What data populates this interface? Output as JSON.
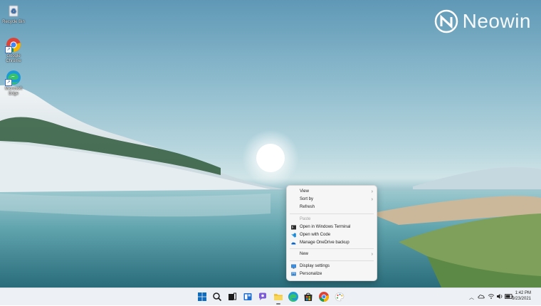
{
  "desktop_icons": [
    {
      "label": "Recycle Bin",
      "icon": "recycle-bin-icon"
    },
    {
      "label": "Google Chrome",
      "icon": "chrome-icon"
    },
    {
      "label": "Microsoft Edge",
      "icon": "edge-icon"
    }
  ],
  "watermark": {
    "text": "Neowin"
  },
  "context_menu": {
    "items": [
      {
        "label": "View",
        "submenu": true
      },
      {
        "label": "Sort by",
        "submenu": true
      },
      {
        "label": "Refresh"
      },
      {
        "label": "Paste",
        "disabled": true
      },
      {
        "label": "Open in Windows Terminal",
        "icon": "terminal-icon"
      },
      {
        "label": "Open with Code",
        "icon": "vscode-icon"
      },
      {
        "label": "Manage OneDrive backup",
        "icon": "onedrive-icon"
      },
      {
        "label": "New",
        "submenu": true
      },
      {
        "label": "Display settings",
        "icon": "display-icon"
      },
      {
        "label": "Personalize",
        "icon": "personalize-icon"
      }
    ]
  },
  "taskbar": {
    "apps": [
      "windows-start-icon",
      "search-icon",
      "task-view-icon",
      "widgets-icon",
      "chat-icon",
      "file-explorer-icon",
      "edge-icon",
      "store-icon",
      "chrome-icon",
      "paint-icon"
    ],
    "tray_icons": [
      "chevron-up-icon",
      "onedrive-icon",
      "wifi-icon",
      "volume-icon",
      "battery-icon"
    ],
    "time": "1:42 PM",
    "date": "9/23/2021"
  },
  "colors": {
    "accent": "#0067c0",
    "menu_bg": "#f6f6f6",
    "taskbar_bg": "#ecf0f4"
  }
}
